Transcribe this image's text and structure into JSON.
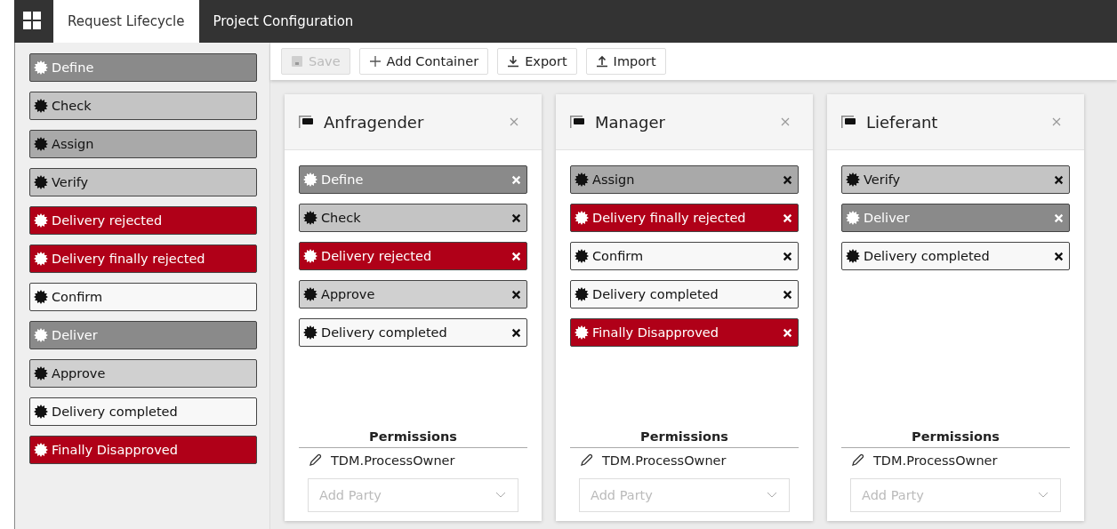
{
  "tabs": [
    {
      "label": "Request Lifecycle",
      "selected": true
    },
    {
      "label": "Project Configuration",
      "selected": false
    }
  ],
  "states": [
    {
      "label": "Define",
      "color": "#8a8a8a"
    },
    {
      "label": "Check",
      "color": "#c4c4c4"
    },
    {
      "label": "Assign",
      "color": "#a9a9a9"
    },
    {
      "label": "Verify",
      "color": "#c4c4c4"
    },
    {
      "label": "Delivery rejected",
      "color": "#b00018"
    },
    {
      "label": "Delivery finally rejected",
      "color": "#b00018"
    },
    {
      "label": "Confirm",
      "color": "#f8f8f8"
    },
    {
      "label": "Deliver",
      "color": "#8a8a8a"
    },
    {
      "label": "Approve",
      "color": "#d0d0d0"
    },
    {
      "label": "Delivery completed",
      "color": "#f8f8f8"
    },
    {
      "label": "Finally Disapproved",
      "color": "#b00018"
    }
  ],
  "toolbar": [
    {
      "label": "Save",
      "kind": "save",
      "disabled": true
    },
    {
      "label": "Add Container",
      "kind": "add",
      "disabled": false
    },
    {
      "label": "Export",
      "kind": "export",
      "disabled": false
    },
    {
      "label": "Import",
      "kind": "import",
      "disabled": false
    }
  ],
  "containers": [
    {
      "title": "Anfragender",
      "states": [
        {
          "label": "Define",
          "color": "#8a8a8a"
        },
        {
          "label": "Check",
          "color": "#c4c4c4"
        },
        {
          "label": "Delivery rejected",
          "color": "#b00018"
        },
        {
          "label": "Approve",
          "color": "#d0d0d0"
        },
        {
          "label": "Delivery completed",
          "color": "#f8f8f8"
        }
      ],
      "permissions_title": "Permissions",
      "permissions": [
        "TDM.ProcessOwner"
      ],
      "party_placeholder": "Add Party"
    },
    {
      "title": "Manager",
      "states": [
        {
          "label": "Assign",
          "color": "#a9a9a9"
        },
        {
          "label": "Delivery finally rejected",
          "color": "#b00018"
        },
        {
          "label": "Confirm",
          "color": "#f8f8f8"
        },
        {
          "label": "Delivery completed",
          "color": "#f8f8f8"
        },
        {
          "label": "Finally Disapproved",
          "color": "#b00018"
        }
      ],
      "permissions_title": "Permissions",
      "permissions": [
        "TDM.ProcessOwner"
      ],
      "party_placeholder": "Add Party"
    },
    {
      "title": "Lieferant",
      "states": [
        {
          "label": "Verify",
          "color": "#c4c4c4"
        },
        {
          "label": "Deliver",
          "color": "#8a8a8a"
        },
        {
          "label": "Delivery completed",
          "color": "#f8f8f8"
        }
      ],
      "permissions_title": "Permissions",
      "permissions": [
        "TDM.ProcessOwner"
      ],
      "party_placeholder": "Add Party"
    }
  ]
}
